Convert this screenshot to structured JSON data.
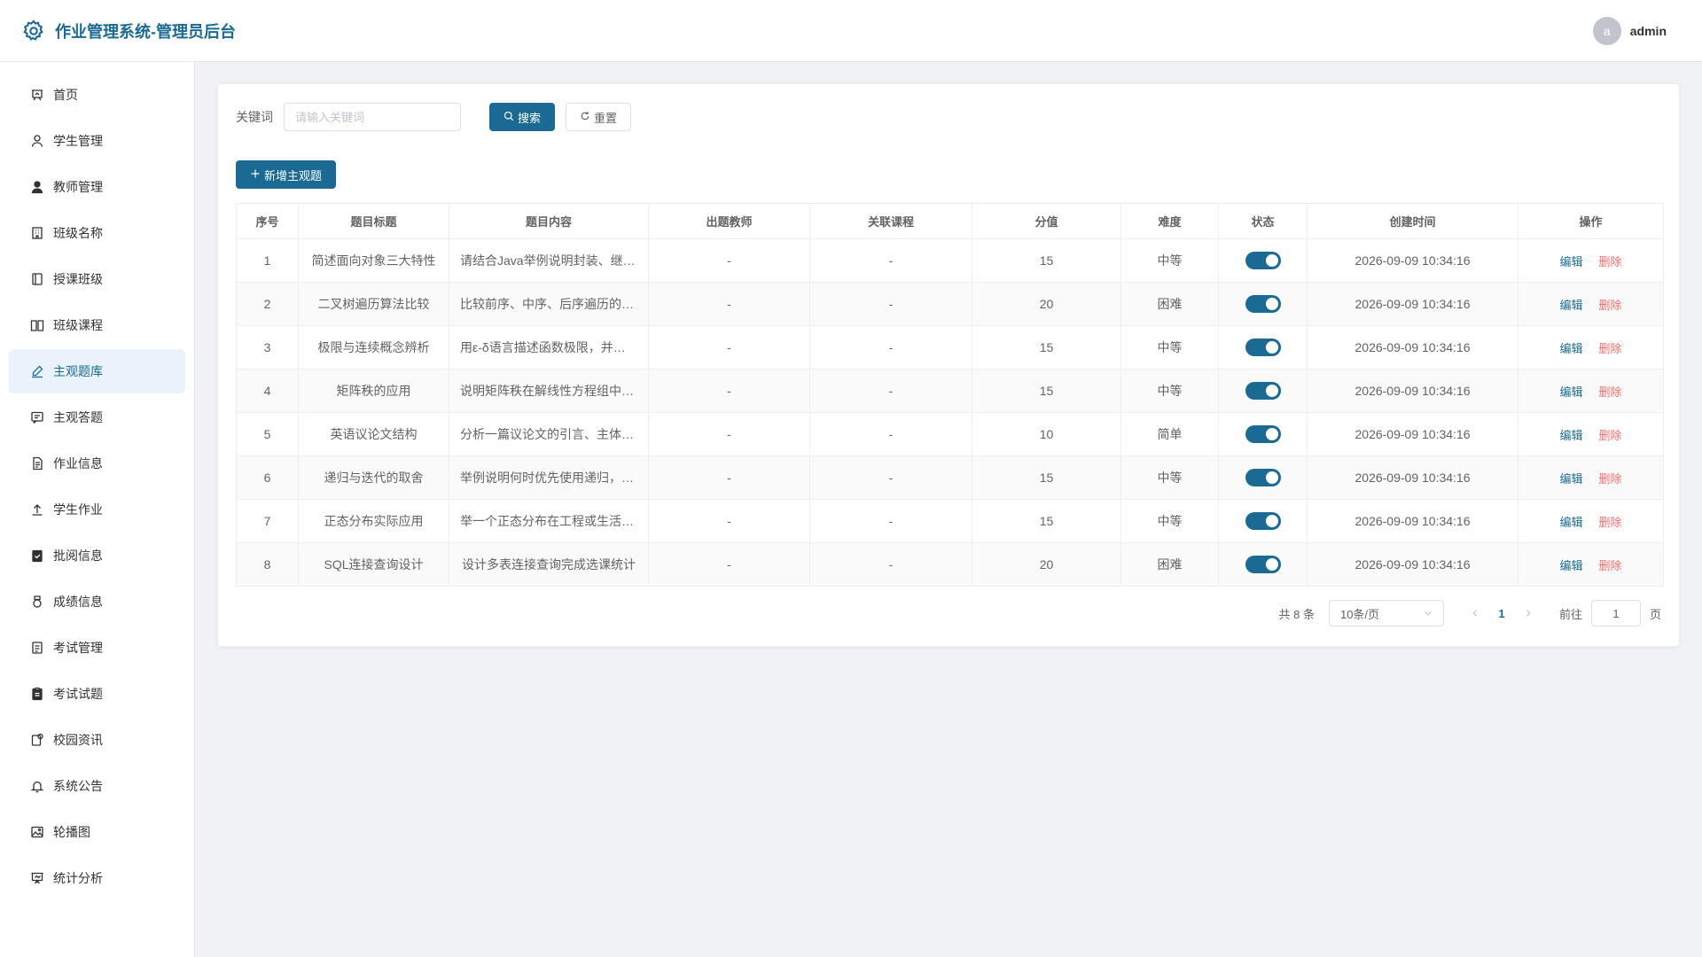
{
  "header": {
    "title": "作业管理系统-管理员后台",
    "avatar_letter": "a",
    "username": "admin"
  },
  "sidebar": {
    "items": [
      {
        "label": "首页",
        "icon": "home-chart-icon"
      },
      {
        "label": "学生管理",
        "icon": "user-outline-icon"
      },
      {
        "label": "教师管理",
        "icon": "user-filled-icon"
      },
      {
        "label": "班级名称",
        "icon": "building-icon"
      },
      {
        "label": "授课班级",
        "icon": "notebook-icon"
      },
      {
        "label": "班级课程",
        "icon": "book-open-icon"
      },
      {
        "label": "主观题库",
        "icon": "edit-pen-icon",
        "active": true
      },
      {
        "label": "主观答题",
        "icon": "chat-icon"
      },
      {
        "label": "作业信息",
        "icon": "document-icon"
      },
      {
        "label": "学生作业",
        "icon": "upload-icon"
      },
      {
        "label": "批阅信息",
        "icon": "clipboard-check-icon"
      },
      {
        "label": "成绩信息",
        "icon": "medal-icon"
      },
      {
        "label": "考试管理",
        "icon": "tickets-icon"
      },
      {
        "label": "考试试题",
        "icon": "clipboard-icon"
      },
      {
        "label": "校园资讯",
        "icon": "news-icon"
      },
      {
        "label": "系统公告",
        "icon": "bell-icon"
      },
      {
        "label": "轮播图",
        "icon": "picture-icon"
      },
      {
        "label": "统计分析",
        "icon": "presentation-icon"
      }
    ]
  },
  "search": {
    "label": "关键词",
    "placeholder": "请输入关键词",
    "value": "",
    "search_button": "搜索",
    "reset_button": "重置"
  },
  "add_button": "新增主观题",
  "table": {
    "headers": [
      "序号",
      "题目标题",
      "题目内容",
      "出题教师",
      "关联课程",
      "分值",
      "难度",
      "状态",
      "创建时间",
      "操作"
    ],
    "edit_label": "编辑",
    "delete_label": "删除",
    "rows": [
      {
        "no": "1",
        "title": "简述面向对象三大特性",
        "content": "请结合Java举例说明封装、继承、多态",
        "teacher": "-",
        "course": "-",
        "score": "15",
        "difficulty": "中等",
        "enabled": true,
        "created": "2026-09-09 10:34:16"
      },
      {
        "no": "2",
        "title": "二叉树遍历算法比较",
        "content": "比较前序、中序、后序遍历的实现方式",
        "teacher": "-",
        "course": "-",
        "score": "20",
        "difficulty": "困难",
        "enabled": true,
        "created": "2026-09-09 10:34:16"
      },
      {
        "no": "3",
        "title": "极限与连续概念辨析",
        "content": "用ε-δ语言描述函数极限，并说明连续",
        "teacher": "-",
        "course": "-",
        "score": "15",
        "difficulty": "中等",
        "enabled": true,
        "created": "2026-09-09 10:34:16"
      },
      {
        "no": "4",
        "title": "矩阵秩的应用",
        "content": "说明矩阵秩在解线性方程组中的作用",
        "teacher": "-",
        "course": "-",
        "score": "15",
        "difficulty": "中等",
        "enabled": true,
        "created": "2026-09-09 10:34:16"
      },
      {
        "no": "5",
        "title": "英语议论文结构",
        "content": "分析一篇议论文的引言、主体与结论",
        "teacher": "-",
        "course": "-",
        "score": "10",
        "difficulty": "简单",
        "enabled": true,
        "created": "2026-09-09 10:34:16"
      },
      {
        "no": "6",
        "title": "递归与迭代的取舍",
        "content": "举例说明何时优先使用递归，何时迭代",
        "teacher": "-",
        "course": "-",
        "score": "15",
        "difficulty": "中等",
        "enabled": true,
        "created": "2026-09-09 10:34:16"
      },
      {
        "no": "7",
        "title": "正态分布实际应用",
        "content": "举一个正态分布在工程或生活中的例子",
        "teacher": "-",
        "course": "-",
        "score": "15",
        "difficulty": "中等",
        "enabled": true,
        "created": "2026-09-09 10:34:16"
      },
      {
        "no": "8",
        "title": "SQL连接查询设计",
        "content": "设计多表连接查询完成选课统计",
        "teacher": "-",
        "course": "-",
        "score": "20",
        "difficulty": "困难",
        "enabled": true,
        "created": "2026-09-09 10:34:16"
      }
    ]
  },
  "pagination": {
    "total_text": "共 8 条",
    "page_size": "10条/页",
    "current_page": "1",
    "goto_label": "前往",
    "goto_value": "1",
    "page_suffix": "页"
  },
  "colors": {
    "primary": "#1a6a93",
    "danger": "#f56c6c",
    "active_bg": "#eaf3fb"
  }
}
